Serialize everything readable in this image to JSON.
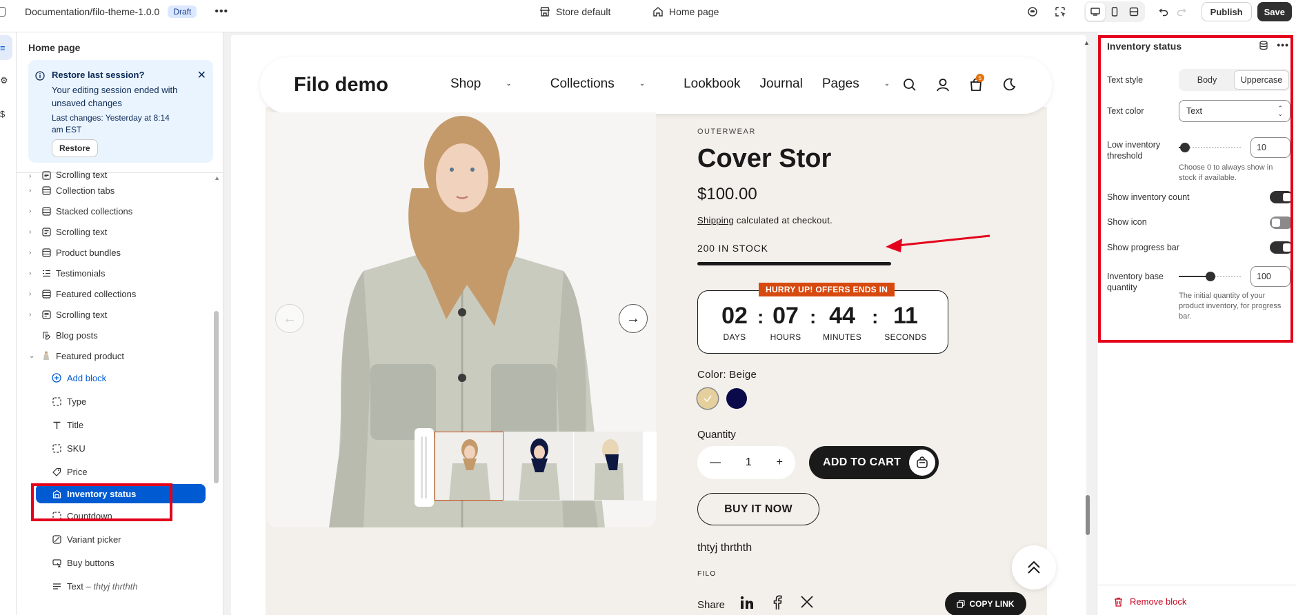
{
  "topbar": {
    "document_path": "Documentation/filo-theme-1.0.0",
    "status_badge": "Draft",
    "store": "Store default",
    "page": "Home page",
    "publish_label": "Publish",
    "save_label": "Save"
  },
  "sidebar": {
    "title": "Home page",
    "restore_banner": {
      "heading": "Restore last session?",
      "message": "Your editing session ended with unsaved changes",
      "last_changes": "Last changes: Yesterday at 8:14 am EST",
      "button": "Restore"
    },
    "sections": [
      {
        "label": "Scrolling text",
        "icon": "text-section-icon"
      },
      {
        "label": "Collection tabs",
        "icon": "grid-section-icon"
      },
      {
        "label": "Stacked collections",
        "icon": "grid-section-icon"
      },
      {
        "label": "Scrolling text",
        "icon": "text-section-icon"
      },
      {
        "label": "Product bundles",
        "icon": "grid-section-icon"
      },
      {
        "label": "Testimonials",
        "icon": "list-section-icon"
      },
      {
        "label": "Featured collections",
        "icon": "grid-section-icon"
      },
      {
        "label": "Scrolling text",
        "icon": "text-section-icon"
      },
      {
        "label": "Blog posts",
        "icon": "blog-icon"
      },
      {
        "label": "Featured product",
        "icon": "product-icon"
      }
    ],
    "blocks": [
      {
        "label": "Add block",
        "icon": "plus-circle-icon"
      },
      {
        "label": "Type",
        "icon": "dashed-square-icon"
      },
      {
        "label": "Title",
        "icon": "text-t-icon"
      },
      {
        "label": "SKU",
        "icon": "dashed-square-icon"
      },
      {
        "label": "Price",
        "icon": "price-tag-icon"
      },
      {
        "label": "Inventory status",
        "icon": "inventory-icon"
      },
      {
        "label": "Countdown",
        "icon": "dashed-square-icon"
      },
      {
        "label": "Variant picker",
        "icon": "variant-icon"
      },
      {
        "label": "Buy buttons",
        "icon": "buy-button-icon"
      },
      {
        "label": "Text",
        "sub": "thtyj thrthth",
        "icon": "text-lines-icon"
      }
    ],
    "text_separator": " – "
  },
  "storefront": {
    "logo": "Filo demo",
    "nav": [
      "Shop",
      "Collections",
      "Lookbook",
      "Journal",
      "Pages"
    ],
    "cart_count": "5",
    "product": {
      "eyebrow": "OUTERWEAR",
      "title": "Cover Stor",
      "price": "$100.00",
      "shipping_link": "Shipping",
      "shipping_text": " calculated at checkout.",
      "stock_text": "200 IN STOCK",
      "stock_fraction": 1.0,
      "countdown_badge": "HURRY UP! OFFERS ENDS IN",
      "countdown": [
        {
          "value": "02",
          "label": "DAYS"
        },
        {
          "value": "07",
          "label": "HOURS"
        },
        {
          "value": "44",
          "label": "MINUTES"
        },
        {
          "value": "11",
          "label": "SECONDS"
        }
      ],
      "countdown_separator": ":",
      "color_label": "Color: Beige",
      "swatches": [
        "#e4cf9d",
        "#0a0a4a"
      ],
      "quantity_label": "Quantity",
      "quantity": "1",
      "add_to_cart": "ADD TO CART",
      "buy_now": "BUY IT NOW",
      "description": "thtyj thrthth",
      "vendor": "FILO",
      "share_label": "Share",
      "copy_link": "COPY LINK"
    }
  },
  "panel": {
    "title": "Inventory status",
    "text_style_label": "Text style",
    "text_style_options": [
      "Body",
      "Uppercase"
    ],
    "text_style_selected": "Uppercase",
    "text_color_label": "Text color",
    "text_color_value": "Text",
    "low_threshold_label": "Low inventory threshold",
    "low_threshold_value": "10",
    "low_threshold_fraction": 0.1,
    "low_threshold_help": "Choose 0 to always show in stock if available.",
    "show_count_label": "Show inventory count",
    "show_count": true,
    "show_icon_label": "Show icon",
    "show_icon": false,
    "show_progress_label": "Show progress bar",
    "show_progress": true,
    "base_qty_label": "Inventory base quantity",
    "base_qty_value": "100",
    "base_qty_fraction": 0.5,
    "base_qty_help": "The initial quantity of your product inventory, for progress bar.",
    "remove_label": "Remove block"
  },
  "colors": {
    "accent": "#005bd3",
    "annotation_red": "#e3001b",
    "countdown_badge": "#d74a0f"
  }
}
